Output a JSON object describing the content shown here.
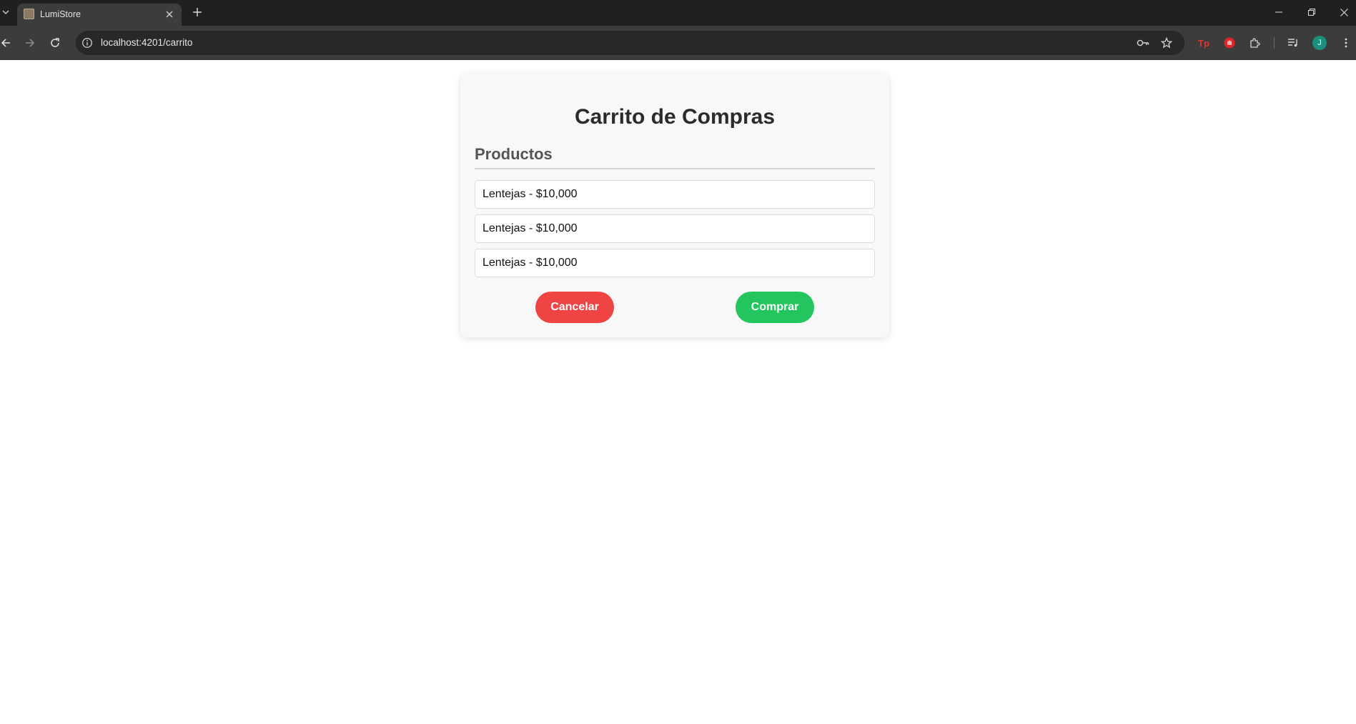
{
  "browser": {
    "tab": {
      "title": "LumiStore",
      "favicon": "store-favicon"
    },
    "address_bar": {
      "url": "localhost:4201/carrito"
    },
    "profile_initial": "J",
    "icons": [
      "tab-list-icon",
      "close-icon",
      "plus-icon",
      "minimize-icon",
      "restore-icon",
      "window-close-icon",
      "back-icon",
      "forward-icon",
      "reload-icon",
      "info-icon",
      "key-icon",
      "star-icon",
      "tp-extension-icon",
      "hand-extension-icon",
      "puzzle-icon",
      "media-icon",
      "menu-icon"
    ]
  },
  "page": {
    "title": "Carrito de Compras",
    "section_title": "Productos",
    "products": [
      {
        "label": "Lentejas - $10,000"
      },
      {
        "label": "Lentejas - $10,000"
      },
      {
        "label": "Lentejas - $10,000"
      }
    ],
    "buttons": {
      "cancel_label": "Cancelar",
      "buy_label": "Comprar"
    }
  },
  "colors": {
    "cancel": "#ef4444",
    "buy": "#22c55e",
    "card_bg": "#f8f8f8"
  }
}
